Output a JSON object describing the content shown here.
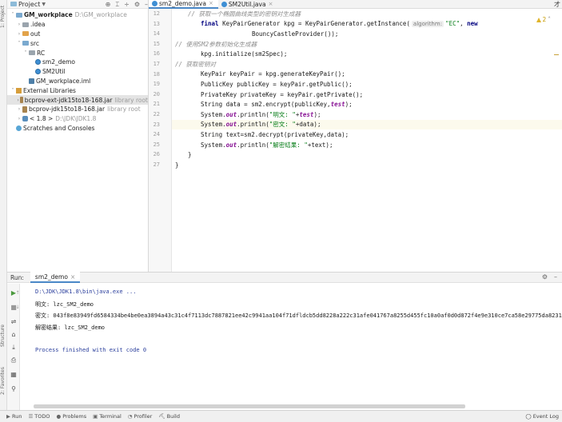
{
  "left_strip": {
    "project": "1: Project",
    "structure": "Structure",
    "favorites": "2: Favorites"
  },
  "project_panel": {
    "title": "Project",
    "tree": [
      {
        "arrow": "down",
        "icon": "blue",
        "name": "GM_workplace",
        "extra": "D:\\GM_workplace",
        "indent": 0,
        "bold": true
      },
      {
        "arrow": "right",
        "icon": "grey",
        "name": ".idea",
        "extra": "",
        "indent": 1
      },
      {
        "arrow": "right",
        "icon": "orange",
        "name": "out",
        "extra": "",
        "indent": 1
      },
      {
        "arrow": "down",
        "icon": "blue",
        "name": "src",
        "extra": "",
        "indent": 1
      },
      {
        "arrow": "down",
        "icon": "grey",
        "name": "RC",
        "extra": "",
        "indent": 2
      },
      {
        "arrow": "",
        "icon": "class",
        "name": "sm2_demo",
        "extra": "",
        "indent": 3
      },
      {
        "arrow": "",
        "icon": "class",
        "name": "SM2Util",
        "extra": "",
        "indent": 3
      },
      {
        "arrow": "",
        "icon": "iml",
        "name": "GM_workplace.iml",
        "extra": "",
        "indent": 2
      },
      {
        "arrow": "down",
        "icon": "lib",
        "name": "External Libraries",
        "extra": "",
        "indent": 0
      },
      {
        "arrow": "right",
        "icon": "jar",
        "name": "bcprov-ext-jdk15to18-168.jar",
        "extra": "library root",
        "indent": 1,
        "selected": true
      },
      {
        "arrow": "right",
        "icon": "jar",
        "name": "bcprov-jdk15to18-168.jar",
        "extra": "library root",
        "indent": 1
      },
      {
        "arrow": "right",
        "icon": "jdk",
        "name": "< 1.8 >",
        "extra": "D:\\JDK\\JDK1.8",
        "indent": 1
      },
      {
        "arrow": "",
        "icon": "scratch",
        "name": "Scratches and Consoles",
        "extra": "",
        "indent": 0
      }
    ]
  },
  "editor_tabs": [
    {
      "label": "sm2_demo.java",
      "active": true
    },
    {
      "label": "SM2Util.java",
      "active": false
    }
  ],
  "corner_char": "才",
  "editor": {
    "warning_count": "2",
    "lines": [
      {
        "num": "12",
        "code": [
          {
            "t": "cm",
            "v": "// 获取一个椭圆曲线类型的密钥对生成器"
          }
        ],
        "indent": 1
      },
      {
        "num": "13",
        "code": [
          {
            "t": "kw",
            "v": "final "
          },
          {
            "t": "",
            "v": "KeyPairGenerator kpg = KeyPairGenerator."
          },
          {
            "t": "",
            "v": "getInstance("
          },
          {
            "t": "hint",
            "v": "algorithm:"
          },
          {
            "t": "st",
            "v": "\"EC\""
          },
          {
            "t": "",
            "v": ", "
          },
          {
            "t": "kw",
            "v": "new"
          }
        ],
        "indent": 2
      },
      {
        "num": "14",
        "code": [
          {
            "t": "",
            "v": "BouncyCastleProvider());"
          }
        ],
        "indent": 6
      },
      {
        "num": "15",
        "code": [
          {
            "t": "cm",
            "v": "// 使用SM2参数初始化生成器"
          }
        ],
        "indent": 0
      },
      {
        "num": "16",
        "code": [
          {
            "t": "",
            "v": "kpg.initialize(sm2Spec);"
          }
        ],
        "indent": 2
      },
      {
        "num": "17",
        "code": [
          {
            "t": "cm",
            "v": "// 获取密钥对"
          }
        ],
        "indent": 0
      },
      {
        "num": "18",
        "code": [
          {
            "t": "",
            "v": "KeyPair keyPair = kpg.generateKeyPair();"
          }
        ],
        "indent": 2
      },
      {
        "num": "19",
        "code": [
          {
            "t": "",
            "v": "PublicKey publicKey = keyPair.getPublic();"
          }
        ],
        "indent": 2
      },
      {
        "num": "20",
        "code": [
          {
            "t": "",
            "v": "PrivateKey privateKey = keyPair.getPrivate();"
          }
        ],
        "indent": 2
      },
      {
        "num": "21",
        "code": [
          {
            "t": "",
            "v": "String data = sm2.encrypt(publicKey,"
          },
          {
            "t": "fld",
            "v": "test"
          },
          {
            "t": "",
            "v": ");"
          }
        ],
        "indent": 2
      },
      {
        "num": "22",
        "code": [
          {
            "t": "",
            "v": "System."
          },
          {
            "t": "fld",
            "v": "out"
          },
          {
            "t": "",
            "v": ".println("
          },
          {
            "t": "st",
            "v": "\"明文: \""
          },
          {
            "t": "",
            "v": "+"
          },
          {
            "t": "fld",
            "v": "test"
          },
          {
            "t": "",
            "v": ");"
          }
        ],
        "indent": 2
      },
      {
        "num": "23",
        "code": [
          {
            "t": "",
            "v": "System."
          },
          {
            "t": "fld",
            "v": "out"
          },
          {
            "t": "",
            "v": ".println("
          },
          {
            "t": "st",
            "v": "\"密文: \""
          },
          {
            "t": "",
            "v": "+data);"
          }
        ],
        "indent": 2,
        "highlight": true
      },
      {
        "num": "24",
        "code": [
          {
            "t": "",
            "v": "String text=sm2.decrypt(privateKey,data);"
          }
        ],
        "indent": 2
      },
      {
        "num": "25",
        "code": [
          {
            "t": "",
            "v": "System."
          },
          {
            "t": "fld",
            "v": "out"
          },
          {
            "t": "",
            "v": ".println("
          },
          {
            "t": "st",
            "v": "\"解密结果: \""
          },
          {
            "t": "",
            "v": "+text);"
          }
        ],
        "indent": 2
      },
      {
        "num": "26",
        "code": [
          {
            "t": "",
            "v": "}"
          }
        ],
        "indent": 1
      },
      {
        "num": "27",
        "code": [
          {
            "t": "",
            "v": "}"
          }
        ],
        "indent": 0
      }
    ]
  },
  "run_panel": {
    "label": "Run:",
    "tab": "sm2_demo",
    "console": [
      {
        "cls": "cmd",
        "text": "D:\\JDK\\JDK1.8\\bin\\java.exe ..."
      },
      {
        "cls": "",
        "text": "明文: lzc_SM2_demo"
      },
      {
        "cls": "",
        "text": "密文: 043f8e83949fd6584334be4be0ea3894a43c31c4f7113dc7887821ee42c9941aa104f71dfldcb5dd8228a222c31afe041767a8255d455fc10a0af0d0d872f4e9e310ce7ca58e29775da8231b369a235ebac4b6ebb0839"
      },
      {
        "cls": "",
        "text": "解密结果: lzc_SM2_demo"
      },
      {
        "cls": "",
        "text": ""
      },
      {
        "cls": "done",
        "text": "Process finished with exit code 0"
      }
    ]
  },
  "statusbar": {
    "items": [
      "Run",
      "TODO",
      "Problems",
      "Terminal",
      "Profiler",
      "Build"
    ],
    "event_log": "Event Log"
  }
}
